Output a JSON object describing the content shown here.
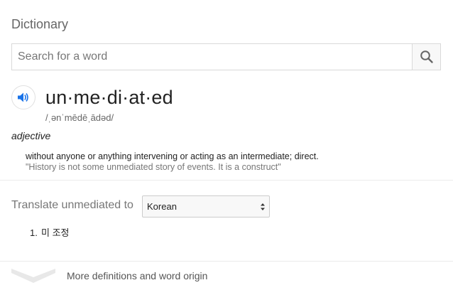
{
  "panel": {
    "title": "Dictionary"
  },
  "search": {
    "placeholder": "Search for a word",
    "value": "",
    "button_icon": "search-icon"
  },
  "entry": {
    "audio_icon": "speaker-icon",
    "headword": "un·me·di·at·ed",
    "phonetic": "/ˌənˈmēdēˌādəd/",
    "part_of_speech": "adjective",
    "definition": "without anyone or anything intervening or acting as an intermediate; direct.",
    "example": "\"History is not some unmediated story of events. It is a construct\""
  },
  "translate": {
    "label": "Translate unmediated to",
    "selected_language": "Korean",
    "results": [
      {
        "number": "1.",
        "text": "미 조정"
      }
    ]
  },
  "footer": {
    "more_icon": "chevron-down-icon",
    "more_label": "More definitions and word origin"
  },
  "colors": {
    "accent": "#1a73e8",
    "muted_text": "#777777",
    "divider": "#ebebeb"
  }
}
